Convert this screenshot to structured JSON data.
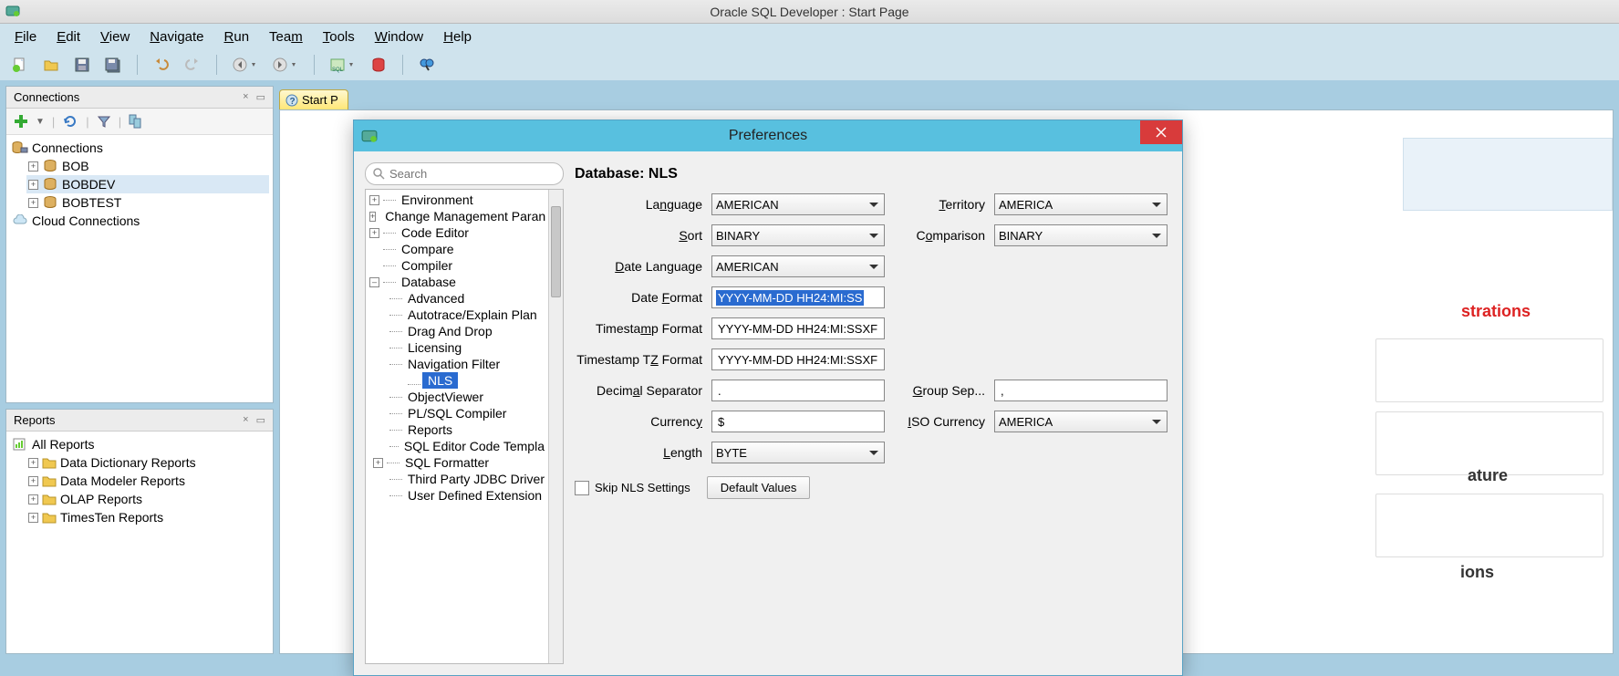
{
  "app": {
    "title": "Oracle SQL Developer : Start Page"
  },
  "menu": {
    "file": "File",
    "edit": "Edit",
    "view": "View",
    "navigate": "Navigate",
    "run": "Run",
    "team": "Team",
    "tools": "Tools",
    "window": "Window",
    "help": "Help"
  },
  "sidebar": {
    "connections_title": "Connections",
    "reports_title": "Reports",
    "connections_root": "Connections",
    "cloud_connections": "Cloud Connections",
    "connections": [
      {
        "name": "BOB"
      },
      {
        "name": "BOBDEV"
      },
      {
        "name": "BOBTEST"
      }
    ],
    "reports_root": "All Reports",
    "reports": [
      {
        "name": "Data Dictionary Reports"
      },
      {
        "name": "Data Modeler Reports"
      },
      {
        "name": "OLAP Reports"
      },
      {
        "name": "TimesTen Reports"
      }
    ]
  },
  "tabs": {
    "start_page": "Start P"
  },
  "background": {
    "strations": "strations",
    "ature": "ature",
    "ions": "ions"
  },
  "dialog": {
    "title": "Preferences",
    "search_placeholder": "Search",
    "heading": "Database: NLS",
    "tree": {
      "environment": "Environment",
      "change_mgmt": "Change Management Paran",
      "code_editor": "Code Editor",
      "compare": "Compare",
      "compiler": "Compiler",
      "database": "Database",
      "advanced": "Advanced",
      "autotrace": "Autotrace/Explain Plan",
      "drag_drop": "Drag And Drop",
      "licensing": "Licensing",
      "nav_filter": "Navigation Filter",
      "nls": "NLS",
      "objectviewer": "ObjectViewer",
      "plsql": "PL/SQL Compiler",
      "reports": "Reports",
      "sql_editor_tpl": "SQL Editor Code Templa",
      "sql_formatter": "SQL Formatter",
      "third_party": "Third Party JDBC Driver",
      "user_defined_ext": "User Defined Extension"
    },
    "labels": {
      "language": "Language",
      "territory": "Territory",
      "sort": "Sort",
      "comparison": "Comparison",
      "date_language": "Date Language",
      "date_format": "Date Format",
      "timestamp_format": "Timestamp Format",
      "timestamp_tz_format": "Timestamp TZ Format",
      "decimal_separator": "Decimal Separator",
      "group_sep": "Group Sep...",
      "currency": "Currency",
      "iso_currency": "ISO Currency",
      "length": "Length",
      "skip_nls": "Skip NLS Settings",
      "default_values": "Default Values"
    },
    "values": {
      "language": "AMERICAN",
      "territory": "AMERICA",
      "sort": "BINARY",
      "comparison": "BINARY",
      "date_language": "AMERICAN",
      "date_format": "YYYY-MM-DD HH24:MI:SS",
      "timestamp_format": "YYYY-MM-DD HH24:MI:SSXF",
      "timestamp_tz_format": "YYYY-MM-DD HH24:MI:SSXF",
      "decimal_separator": ".",
      "group_sep": ",",
      "currency": "$",
      "iso_currency": "AMERICA",
      "length": "BYTE"
    }
  }
}
